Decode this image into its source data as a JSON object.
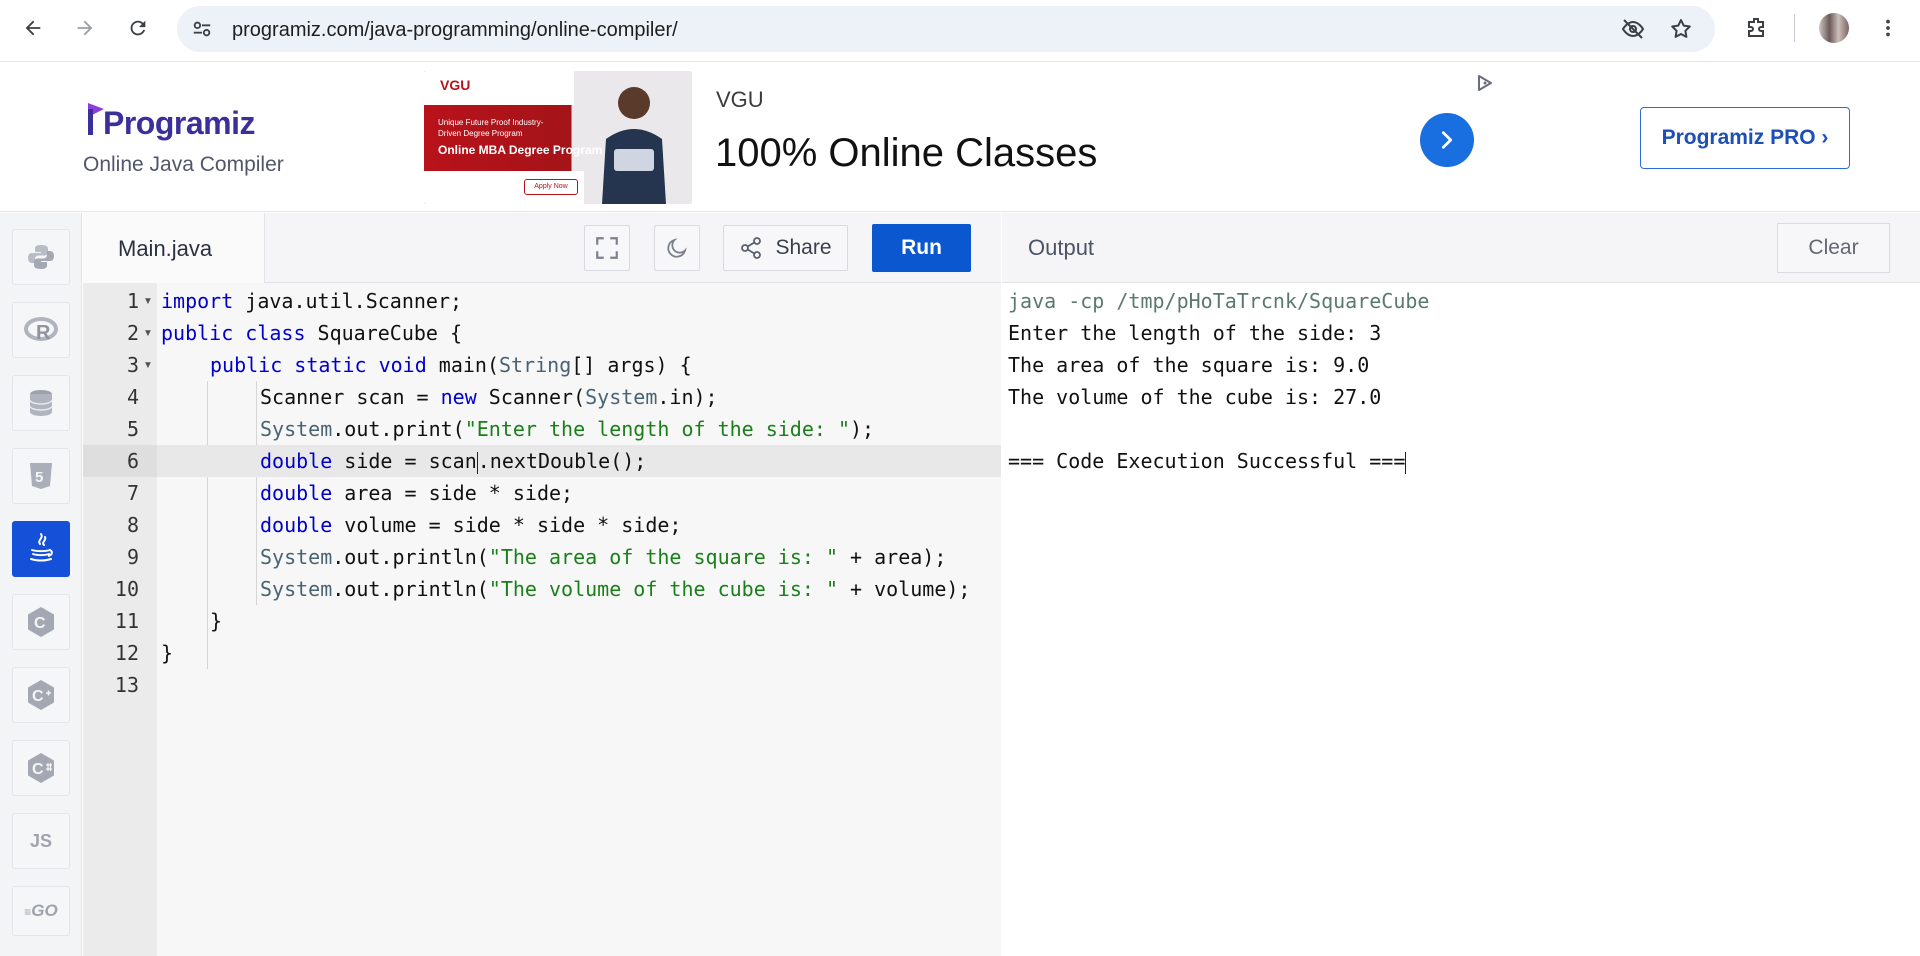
{
  "browser": {
    "url": "programiz.com/java-programming/online-compiler/"
  },
  "header": {
    "logo_text": "Programiz",
    "subtitle": "Online Java Compiler",
    "ad": {
      "brand_small": "VGU",
      "image_line1": "Unique Future Proof Industry-Driven Degree Program",
      "image_line2": "Online MBA Degree Program",
      "image_apply": "Apply Now",
      "sponsor": "VGU",
      "headline": "100% Online Classes"
    },
    "pro_button": "Programiz PRO ›"
  },
  "sidebar": {
    "languages": [
      {
        "name": "python",
        "label": ""
      },
      {
        "name": "r",
        "label": "R"
      },
      {
        "name": "sql",
        "label": ""
      },
      {
        "name": "html",
        "label": "5"
      },
      {
        "name": "java",
        "label": "",
        "active": true
      },
      {
        "name": "c",
        "label": "C"
      },
      {
        "name": "cpp",
        "label": "C"
      },
      {
        "name": "csharp",
        "label": "C"
      },
      {
        "name": "js",
        "label": "JS"
      },
      {
        "name": "go",
        "label": "GO"
      }
    ]
  },
  "editor": {
    "file_name": "Main.java",
    "share_label": "Share",
    "run_label": "Run",
    "line_numbers": [
      "1",
      "2",
      "3",
      "4",
      "5",
      "6",
      "7",
      "8",
      "9",
      "10",
      "11",
      "12",
      "13"
    ],
    "highlighted_line": 6
  },
  "output": {
    "title": "Output",
    "clear_label": "Clear",
    "lines": [
      "java -cp /tmp/pHoTaTrcnk/SquareCube",
      "Enter the length of the side: 3",
      "The area of the square is: 9.0",
      "The volume of the cube is: 27.0",
      "",
      "=== Code Execution Successful ==="
    ]
  },
  "code_tokens": {
    "l1_import": "import",
    "l1_rest": " java.util.Scanner;",
    "l2_public": "public",
    "l2_class": " class",
    "l2_rest": " SquareCube {",
    "l3_public": "public",
    "l3_static": " static",
    "l3_void": " void",
    "l3_main": " main(",
    "l3_string": "String",
    "l3_rest": "[] args) {",
    "l4_a": "Scanner scan ",
    "l4_eq": "=",
    "l4_new": " new",
    "l4_b": " Scanner(",
    "l4_sys": "System",
    "l4_c": ".in);",
    "l5_sys": "System",
    "l5_a": ".out.print(",
    "l5_str": "\"Enter the length of the side: \"",
    "l5_b": ");",
    "l6_double": "double",
    "l6_a": " side ",
    "l6_eq": "=",
    "l6_b": " scan",
    "l6_c": ".nextDouble();",
    "l7_double": "double",
    "l7_a": " area ",
    "l7_eq": "=",
    "l7_b": " side ",
    "l7_op": "*",
    "l7_c": " side;",
    "l8_double": "double",
    "l8_a": " volume ",
    "l8_eq": "=",
    "l8_b": " side ",
    "l8_op1": "*",
    "l8_c": " side ",
    "l8_op2": "*",
    "l8_d": " side;",
    "l9_sys": "System",
    "l9_a": ".out.println(",
    "l9_str": "\"The area of the square is: \"",
    "l9_op": " +",
    "l9_b": " area);",
    "l10_sys": "System",
    "l10_a": ".out.println(",
    "l10_str": "\"The volume of the cube is: \"",
    "l10_op": " +",
    "l10_b": " volume);",
    "l11": "}",
    "l12": "}"
  },
  "colors": {
    "keyword": "#0000cd",
    "type": "#4a6373",
    "string": "#1a7f1a",
    "run_button": "#0b57d0",
    "active_language": "#1551d8",
    "logo": "#3b2f9c"
  }
}
